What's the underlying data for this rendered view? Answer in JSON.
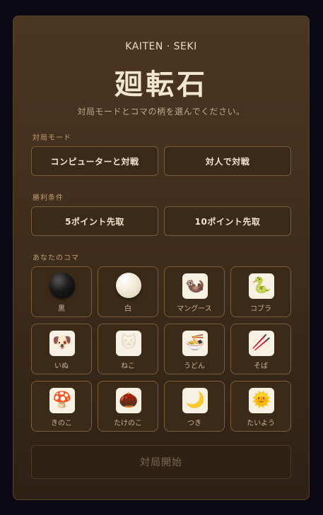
{
  "header": {
    "brand": "KAITEN · SEKI",
    "title": "廻転石",
    "description": "対局モードとコマの柄を選んでください。"
  },
  "mode": {
    "label": "対局モード",
    "options": [
      "コンピューターと対戦",
      "対人で対戦"
    ]
  },
  "win": {
    "label": "勝利条件",
    "options": [
      "5ポイント先取",
      "10ポイント先取"
    ]
  },
  "pieces": {
    "label": "あなたのコマ",
    "items": [
      {
        "name": "黒",
        "icon": "black-stone"
      },
      {
        "name": "白",
        "icon": "white-stone"
      },
      {
        "name": "マングース",
        "icon": "mongoose-icon"
      },
      {
        "name": "コブラ",
        "icon": "cobra-icon"
      },
      {
        "name": "いぬ",
        "icon": "dog-icon"
      },
      {
        "name": "ねこ",
        "icon": "cat-icon"
      },
      {
        "name": "うどん",
        "icon": "udon-icon"
      },
      {
        "name": "そば",
        "icon": "soba-icon"
      },
      {
        "name": "きのこ",
        "icon": "mushroom-icon"
      },
      {
        "name": "たけのこ",
        "icon": "bamboo-shoot-icon"
      },
      {
        "name": "つき",
        "icon": "moon-icon"
      },
      {
        "name": "たいよう",
        "icon": "sun-icon"
      }
    ]
  },
  "start_label": "対局開始"
}
